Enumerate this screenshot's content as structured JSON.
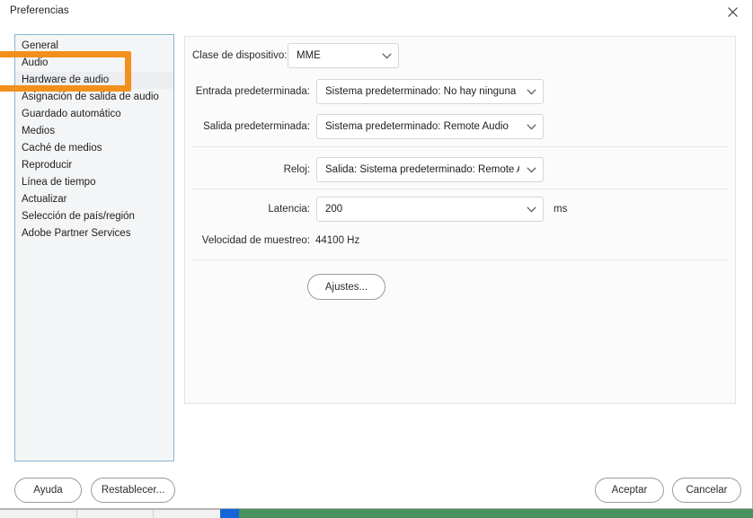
{
  "window": {
    "title": "Preferencias",
    "close_icon": "close-icon"
  },
  "sidebar": {
    "items": [
      {
        "label": "General",
        "selected": false
      },
      {
        "label": "Audio",
        "selected": false
      },
      {
        "label": "Hardware de audio",
        "selected": true
      },
      {
        "label": "Asignación de salida de audio",
        "selected": false
      },
      {
        "label": "Guardado automático",
        "selected": false
      },
      {
        "label": "Medios",
        "selected": false
      },
      {
        "label": "Caché de medios",
        "selected": false
      },
      {
        "label": "Reproducir",
        "selected": false
      },
      {
        "label": "Línea de tiempo",
        "selected": false
      },
      {
        "label": "Actualizar",
        "selected": false
      },
      {
        "label": "Selección de país/región",
        "selected": false
      },
      {
        "label": "Adobe Partner Services",
        "selected": false
      }
    ]
  },
  "annotation": {
    "color": "#f2901e",
    "shape": "rectangle-highlight",
    "targets": "Audio / Hardware de audio"
  },
  "main": {
    "fields": {
      "device_class": {
        "label": "Clase de dispositivo:",
        "value": "MME"
      },
      "default_input": {
        "label": "Entrada predeterminada:",
        "value": "Sistema predeterminado: No hay ninguna ..."
      },
      "default_output": {
        "label": "Salida predeterminada:",
        "value": "Sistema predeterminado: Remote Audio"
      },
      "clock": {
        "label": "Reloj:",
        "value": "Salida: Sistema predeterminado: Remote A..."
      },
      "latency": {
        "label": "Latencia:",
        "value": "200",
        "unit": "ms"
      },
      "sample_rate": {
        "label": "Velocidad de muestreo:",
        "value": "44100 Hz"
      }
    },
    "settings_button": "Ajustes..."
  },
  "footer": {
    "help": "Ayuda",
    "reset": "Restablecer...",
    "accept": "Aceptar",
    "cancel": "Cancelar"
  }
}
